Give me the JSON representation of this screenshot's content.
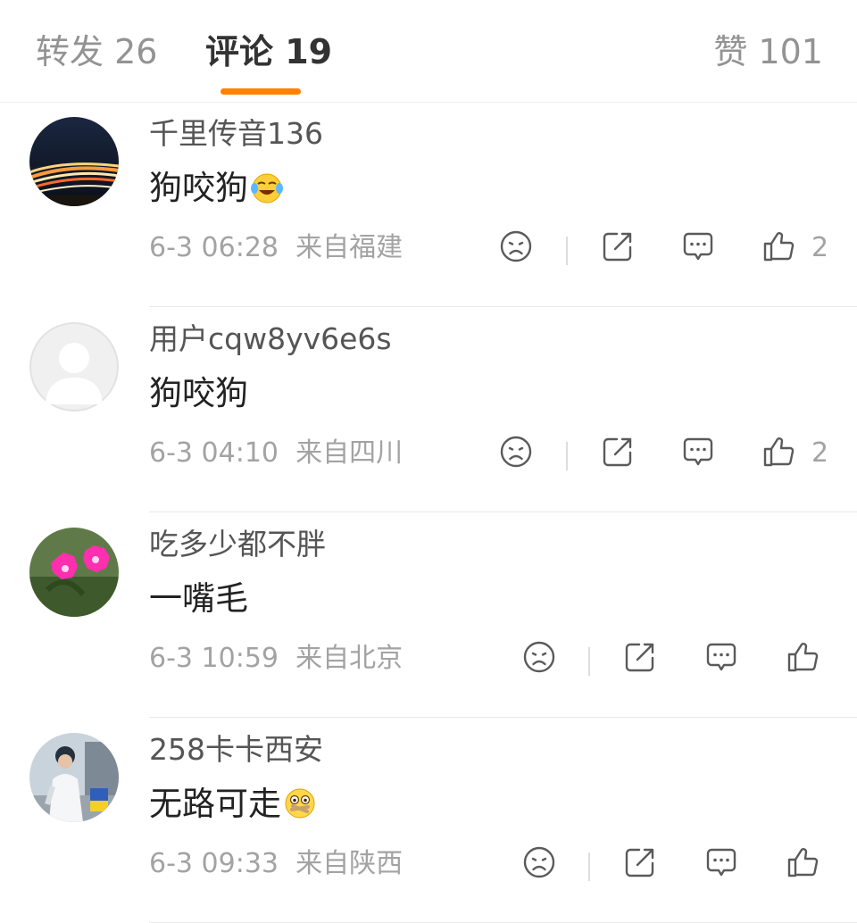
{
  "tabs": {
    "repost": "转发 26",
    "comments": "评论 19",
    "likes": "赞 101"
  },
  "colors": {
    "accent": "#ff8200",
    "text_primary": "#222222",
    "text_secondary": "#a3a3a3"
  },
  "comments": [
    {
      "user": "千里传音136",
      "text": "狗咬狗",
      "emoji": "laughing-tears-emoji",
      "time": "6-3 06:28",
      "location": "来自福建",
      "likes": "2",
      "avatar": "night-highway-photo"
    },
    {
      "user": "用户cqw8yv6e6s",
      "text": "狗咬狗",
      "emoji": "",
      "time": "6-3 04:10",
      "location": "来自四川",
      "likes": "2",
      "avatar": "default-avatar"
    },
    {
      "user": "吃多少都不胖",
      "text": "一嘴毛",
      "emoji": "",
      "time": "6-3 10:59",
      "location": "来自北京",
      "likes": "",
      "avatar": "pink-flowers-photo"
    },
    {
      "user": "258卡卡西安",
      "text": "无路可走",
      "emoji": "zipped-mouth-emoji",
      "time": "6-3 09:33",
      "location": "来自陕西",
      "likes": "",
      "avatar": "person-street-photo"
    }
  ],
  "action_icons": [
    "sad-face-icon",
    "share-icon",
    "reply-icon",
    "like-icon"
  ]
}
